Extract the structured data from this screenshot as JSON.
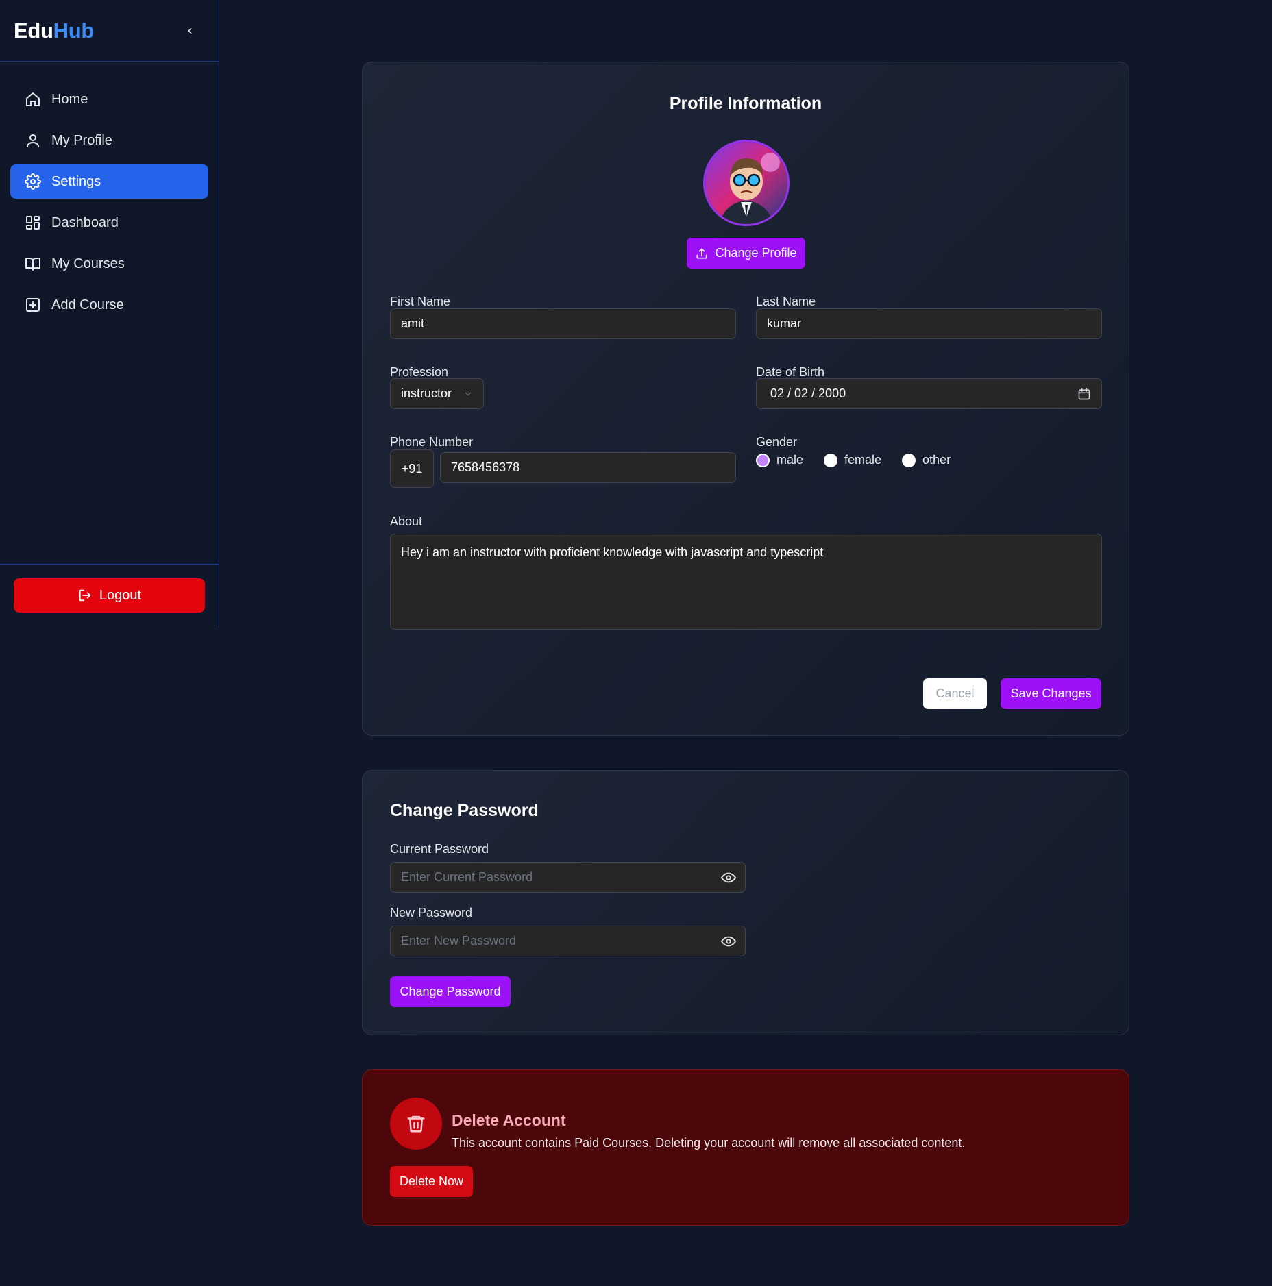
{
  "brand": {
    "part1": "Edu",
    "part2": "Hub"
  },
  "sidebar": {
    "items": [
      {
        "label": "Home",
        "icon": "home-icon"
      },
      {
        "label": "My Profile",
        "icon": "user-icon"
      },
      {
        "label": "Settings",
        "icon": "gear-icon",
        "active": true
      },
      {
        "label": "Dashboard",
        "icon": "dashboard-icon"
      },
      {
        "label": "My Courses",
        "icon": "book-icon"
      },
      {
        "label": "Add Course",
        "icon": "plus-square-icon"
      }
    ],
    "logout_label": "Logout"
  },
  "profile": {
    "title": "Profile Information",
    "change_profile_label": "Change Profile",
    "first_name_label": "First Name",
    "first_name_value": "amit",
    "last_name_label": "Last Name",
    "last_name_value": "kumar",
    "profession_label": "Profession",
    "profession_value": "instructor",
    "dob_label": "Date of Birth",
    "dob_value": "02 / 02 / 2000",
    "phone_label": "Phone Number",
    "phone_code": "+91",
    "phone_value": "7658456378",
    "gender_label": "Gender",
    "gender_options": [
      "male",
      "female",
      "other"
    ],
    "gender_selected": "male",
    "about_label": "About",
    "about_value": "Hey i am an instructor with proficient knowledge with javascript and typescript",
    "cancel_label": "Cancel",
    "save_label": "Save Changes"
  },
  "password": {
    "title": "Change Password",
    "current_label": "Current Password",
    "current_placeholder": "Enter Current Password",
    "new_label": "New Password",
    "new_placeholder": "Enter New Password",
    "button_label": "Change Password"
  },
  "delete": {
    "title": "Delete Account",
    "description": "This account contains Paid Courses. Deleting your account will remove all associated content.",
    "button_label": "Delete Now"
  },
  "colors": {
    "accent_purple": "#9c11f5",
    "active_blue": "#2563eb",
    "danger_red": "#e3060f",
    "background": "#0f1729"
  }
}
